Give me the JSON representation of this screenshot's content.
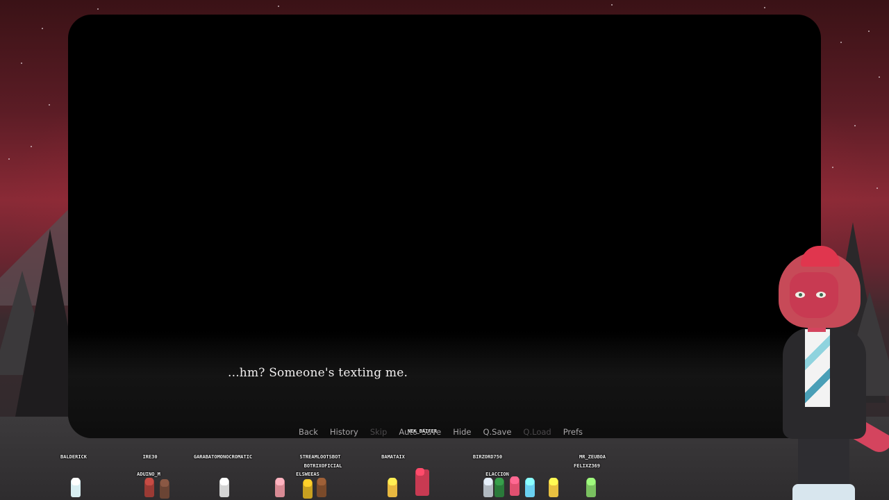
{
  "game": {
    "dialogue": "...hm? Someone's texting me.",
    "quick_menu": [
      {
        "label": "Back",
        "enabled": true
      },
      {
        "label": "History",
        "enabled": true
      },
      {
        "label": "Skip",
        "enabled": false
      },
      {
        "label": "Auto",
        "enabled": true
      },
      {
        "label": "Save",
        "enabled": true
      },
      {
        "label": "Hide",
        "enabled": true
      },
      {
        "label": "Q.Save",
        "enabled": true
      },
      {
        "label": "Q.Load",
        "enabled": false
      },
      {
        "label": "Prefs",
        "enabled": true
      }
    ]
  },
  "chat_overlay": {
    "names": [
      "BALDERICK",
      "IRE30",
      "ADUINO_M",
      "GARABATOMONOCROMATIC",
      "STREAMLOOTSBOT",
      "BOTRIXOFICIAL",
      "ELSWEEAS",
      "NEK_BAIFER",
      "BAMATAIX",
      "BIRZORD750",
      "ELACCION",
      "MR_ZEUBOA",
      "FELIXZ369"
    ]
  },
  "colors": {
    "sky_red": "#8a2a36",
    "viewport_bg": "#000000",
    "dialogue_text": "#f2f0f0",
    "menu_text": "#a8a6a8",
    "menu_disabled": "#4c4a4c",
    "character_skin": "#c83a52"
  },
  "icons": {
    "character": "red-lizard-character-sprite",
    "chat_avatars": "pixel-avatar-sprite"
  }
}
